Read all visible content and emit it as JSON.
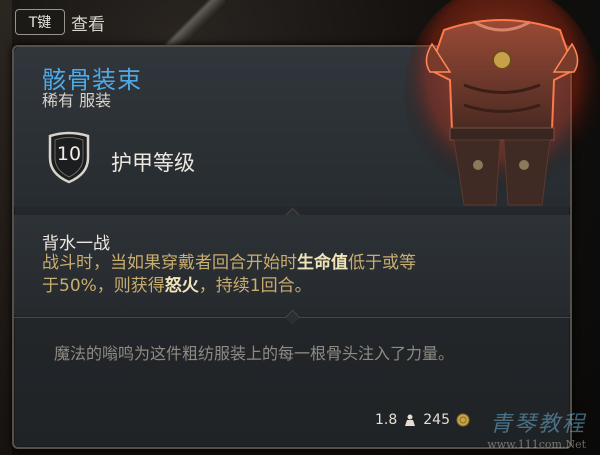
{
  "hint": {
    "key_label": "T键",
    "action_label": "查看"
  },
  "item": {
    "name": "骸骨装束",
    "rarity_type": "稀有 服装",
    "armor_class_value": "10",
    "armor_class_label": "护甲等级",
    "effect": {
      "title": "背水一战",
      "line1_pre": "战斗时，当如果穿戴者回合开始时",
      "line1_hl": "生命值",
      "line1_post": "低于或等",
      "line2_pre": "于50%，则获得",
      "line2_hl": "怒火",
      "line2_post": "，持续1回合。"
    },
    "flavor": "魔法的嗡鸣为这件粗纺服装上的每一根骨头注入了力量。",
    "weight": "1.8",
    "price": "245"
  },
  "watermark": {
    "main": "青琴教程",
    "url": "www.111com.Net"
  },
  "colors": {
    "name_blue": "#4fa9e6",
    "effect_gold": "#c9ad6e",
    "highlight": "#f1e3b8",
    "flavor_grey": "#8f8b84",
    "panel": "#2a2f34"
  },
  "icons": [
    "shield-icon",
    "weight-icon",
    "coin-icon"
  ]
}
